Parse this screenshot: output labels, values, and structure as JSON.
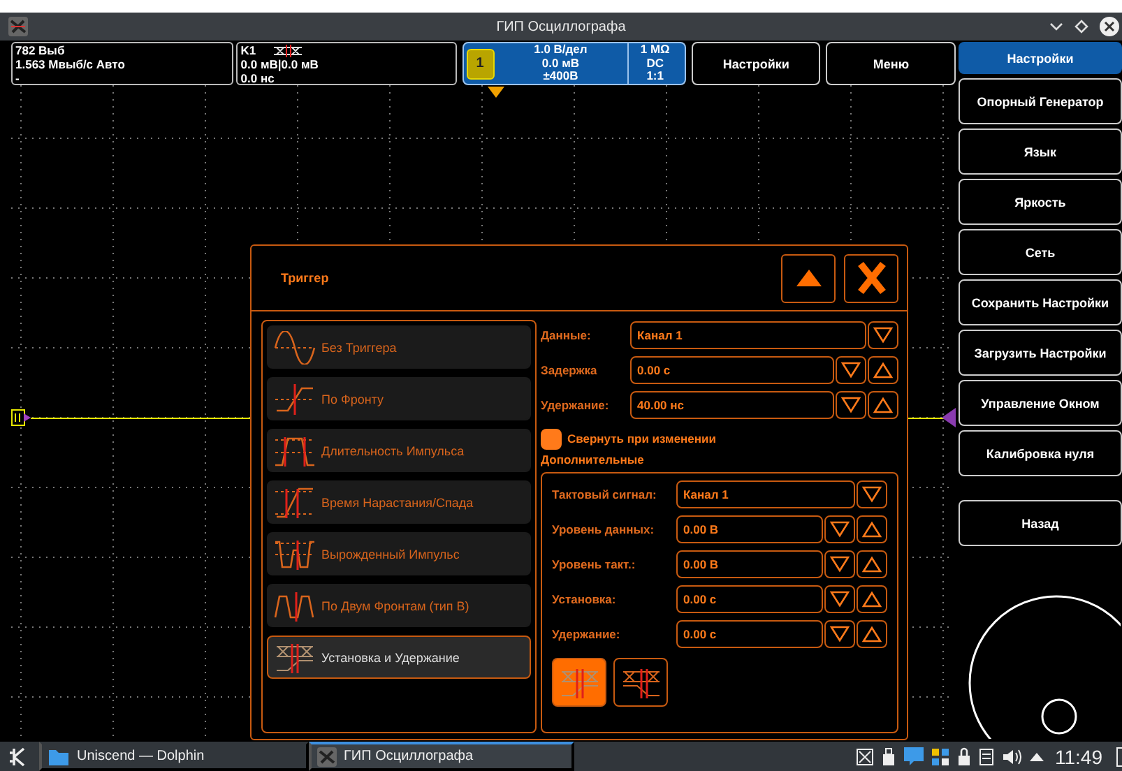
{
  "window": {
    "title": "ГИП Осциллографа"
  },
  "header": {
    "acquisition": [
      "782 Выб",
      "1.563 Мвыб/с Авто",
      "-"
    ],
    "trigger_info": {
      "label": "K1",
      "lines": [
        "0.0 мВ|0.0 мВ",
        "0.0 нс"
      ]
    },
    "channel": {
      "number": "1",
      "lines": [
        "1.0 В/дел",
        "0.0 мВ",
        "±400В"
      ],
      "coupling": [
        "1 MΩ",
        "DC",
        "1:1"
      ]
    },
    "buttons": [
      "Настройки",
      "Меню"
    ]
  },
  "sidebar": {
    "items": [
      {
        "label": "Настройки",
        "selected": true
      },
      {
        "label": "Опорный Генератор",
        "selected": false
      },
      {
        "label": "Язык",
        "selected": false
      },
      {
        "label": "Яркость",
        "selected": false
      },
      {
        "label": "Сеть",
        "selected": false
      },
      {
        "label": "Сохранить Настройки",
        "selected": false
      },
      {
        "label": "Загрузить Настройки",
        "selected": false
      },
      {
        "label": "Управление Окном",
        "selected": false
      },
      {
        "label": "Калибровка нуля",
        "selected": false
      }
    ],
    "back_button": "Назад"
  },
  "dialog": {
    "title": "Триггер",
    "trigger_types": [
      {
        "kind": "none",
        "label": "Без Триггера",
        "selected": false
      },
      {
        "kind": "edge",
        "label": "По Фронту",
        "selected": false
      },
      {
        "kind": "pulse",
        "label": "Длительность Импульса",
        "selected": false
      },
      {
        "kind": "rise",
        "label": "Время Нарастания/Спада",
        "selected": false
      },
      {
        "kind": "runt",
        "label": "Вырожденный Импульс",
        "selected": false
      },
      {
        "kind": "dual",
        "label": "По Двум Фронтам (тип B)",
        "selected": false
      },
      {
        "kind": "setup",
        "label": "Установка и Удержание",
        "selected": true
      }
    ],
    "fields": [
      {
        "kind": "select",
        "label": "Данные:",
        "value": "Канал 1"
      },
      {
        "kind": "spin",
        "label": "Задержка",
        "value": "0.00 с"
      },
      {
        "kind": "spin",
        "label": "Удержание:",
        "value": "40.00 нс"
      }
    ],
    "collapse_checkbox": {
      "label": "Свернуть при изменении",
      "checked": true
    },
    "advanced_title": "Дополнительные",
    "advanced_fields": [
      {
        "kind": "select",
        "label": "Тактовый сигнал:",
        "value": "Канал 1"
      },
      {
        "kind": "spin",
        "label": "Уровень данных:",
        "value": "0.00 В"
      },
      {
        "kind": "spin",
        "label": "Уровень такт.:",
        "value": "0.00 В"
      },
      {
        "kind": "spin",
        "label": "Установка:",
        "value": "0.00 с"
      },
      {
        "kind": "spin",
        "label": "Удержание:",
        "value": "0.00 с"
      }
    ],
    "mode_buttons": [
      {
        "kind": "setup",
        "selected": true
      },
      {
        "kind": "hold",
        "selected": false
      }
    ]
  },
  "taskbar": {
    "tasks": [
      {
        "label": "Uniscend — Dolphin",
        "selected": false
      },
      {
        "label": "ГИП Осциллографа",
        "selected": true
      }
    ],
    "clock": "11:49"
  }
}
